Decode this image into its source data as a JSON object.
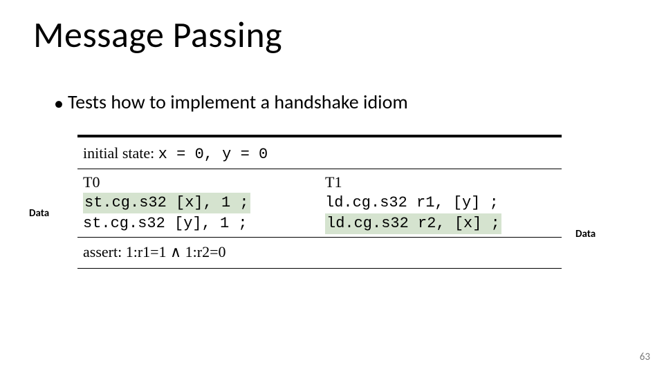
{
  "title": "Message Passing",
  "bullet": "Tests how to implement a handshake idiom",
  "initial_state": {
    "label": "initial state:",
    "expr": "x = 0, y = 0"
  },
  "threads": {
    "t0": {
      "label": "T0",
      "lines": [
        "st.cg.s32 [x], 1 ;",
        "st.cg.s32 [y], 1 ;"
      ],
      "highlight": [
        true,
        false
      ]
    },
    "t1": {
      "label": "T1",
      "lines": [
        "ld.cg.s32 r1, [y] ;",
        "ld.cg.s32 r2, [x] ;"
      ],
      "highlight": [
        false,
        true
      ]
    }
  },
  "assert": {
    "label": "assert:",
    "expr": "1:r1=1 ∧ 1:r2=0"
  },
  "annotations": {
    "left": "Data",
    "right": "Data"
  },
  "page_number": "63"
}
